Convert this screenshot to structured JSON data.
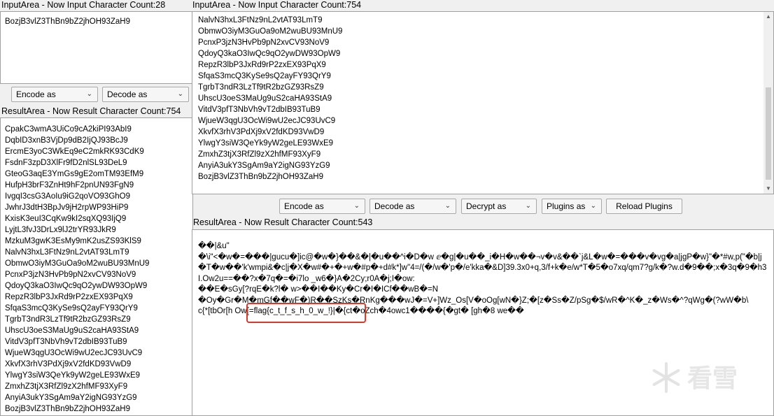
{
  "input_area": {
    "label": "InputArea - Now Input Character Count:28",
    "value": "BozjB3vlZ3ThBn9bZ2jhOH93ZaH9"
  },
  "left_controls": {
    "encode": "Encode as",
    "decode": "Decode as"
  },
  "left_result": {
    "label": "ResultArea - Now Result Character Count:754",
    "lines": [
      "CpakC3wmA3UiCo9cA2kiPI93AbI9",
      "DqbID3xnB3VjDp9dB2IjQJ93BcJ9",
      "ErcmE3yoC3WkEq9eC2mkRK93CdK9",
      "FsdnF3zpD3XlFr9fD2nlSL93DeL9",
      "GteoG3aqE3YmGs9gE2omTM93EfM9",
      "HufpH3brF3ZnHt9hF2pnUN93FgN9",
      "IvgqI3csG3AoIu9iG2qoVO93GhO9",
      "JwhrJ3dtH3BpJv9jH2rpWP93HiP9",
      "KxisK3euI3CqKw9kI2sqXQ93IjQ9",
      "LyjtL3fvJ3DrLx9lJ2trYR93JkR9",
      "MzkuM3gwK3EsMy9mK2usZS93KlS9",
      "NalvN3hxL3FtNz9nL2vtAT93LmT9",
      "ObmwO3iyM3GuOa9oM2wuBU93MnU9",
      "PcnxP3jzN3HvPb9pN2xvCV93NoV9",
      "QdoyQ3kaO3IwQc9qO2ywDW93OpW9",
      "RepzR3lbP3JxRd9rP2zxEX93PqX9",
      "SfqaS3mcQ3KySe9sQ2ayFY93QrY9",
      "TgrbT3ndR3LzTf9tR2bzGZ93RsZ9",
      "UhscU3oeS3MaUg9uS2caHA93StA9",
      "VitdV3pfT3NbVh9vT2dbIB93TuB9",
      "WjueW3qgU3OcWi9wU2ecJC93UvC9",
      "XkvfX3rhV3PdXj9xV2fdKD93VwD9",
      "YlwgY3siW3QeYk9yW2geLE93WxE9",
      "ZmxhZ3tjX3RfZl9zX2hfMF93XyF9",
      "AnyiA3ukY3SgAm9aY2igNG93YzG9",
      "BozjB3vlZ3ThBn9bZ2jhOH93ZaH9"
    ]
  },
  "right_input": {
    "label": "InputArea - Now Input Character Count:754",
    "lines": [
      "NalvN3hxL3FtNz9nL2vtAT93LmT9",
      "ObmwO3iyM3GuOa9oM2wuBU93MnU9",
      "PcnxP3jzN3HvPb9pN2xvCV93NoV9",
      "QdoyQ3kaO3IwQc9qO2ywDW93OpW9",
      "RepzR3lbP3JxRd9rP2zxEX93PqX9",
      "SfqaS3mcQ3KySe9sQ2ayFY93QrY9",
      "TgrbT3ndR3LzTf9tR2bzGZ93RsZ9",
      "UhscU3oeS3MaUg9uS2caHA93StA9",
      "VitdV3pfT3NbVh9vT2dbIB93TuB9",
      "WjueW3qgU3OcWi9wU2ecJC93UvC9",
      "XkvfX3rhV3PdXj9xV2fdKD93VwD9",
      "YlwgY3siW3QeYk9yW2geLE93WxE9",
      "ZmxhZ3tjX3RfZl9zX2hfMF93XyF9",
      "AnyiA3ukY3SgAm9aY2igNG93YzG9",
      "BozjB3vlZ3ThBn9bZ2jhOH93ZaH9"
    ]
  },
  "right_controls": {
    "encode": "Encode as",
    "decode": "Decode as",
    "decrypt": "Decrypt as",
    "plugins": "Plugins as",
    "reload": "Reload Plugins"
  },
  "right_result": {
    "label": "ResultArea - Now Result Character Count:543",
    "lines": [
      "��|&u\"",
      "�\\i\"<�w�=���|gucu�]ic@�w�}��&�|�u��^i�D�w           ⅇ�g|�u��_i�H�w��¬v�v&��`j&L�w�=���v�vg�a|jgP�w}\"�*#w,p(\"�b|j�T�w��'k'wmpi&�c|j�X�w#�+�+w�#p�+d#k*]w\"4=/(�/w�'p�/e'kka�&D]39.3x0+q,3/f+k�e/w*T�5�o7xq/qm7?g/k�?w.d�9��;x�3q�9�h3I.Ow2u==��?x�7q�=�i7lo    _w6�}A�2Cy;r0A�j;I�ow:",
      "��E�sGy[?rqE�k?l� w>��I��Ky�Cr�I�ICf��wB�=N",
      "�Oy�Gr�M�mGf��wF�)R��SzKs�RnKg���wJ�=V+]Wz_Os[V�oOg[wN�}Z;�[z�Ss�Z/pSg�$/wR�^K�_z�Ws�^?qWg�(?wW�b\\",
      "c{*[tbOr[h Ow[=flag{c_t_f_s_h_0_w_!}|�{ct�oZch�4owc1����{�gt� [gh�8 we��"
    ]
  },
  "watermark": {
    "text": "看雪"
  }
}
